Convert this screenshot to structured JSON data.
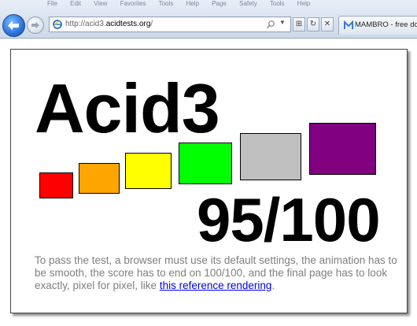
{
  "browser": {
    "menu_items": [
      "File",
      "Edit",
      "View",
      "Favorites",
      "Tools",
      "Help",
      "Page",
      "Safety",
      "Tools",
      "Help"
    ],
    "address": {
      "prefix": "http://acid3.",
      "domain": "acidtests.org",
      "suffix": "/"
    },
    "tab": {
      "label": "MAMBRO - free do"
    },
    "buttons": {
      "compat": "⊞",
      "refresh": "↻",
      "stop": "✕"
    }
  },
  "page": {
    "title": "Acid3",
    "score": "95/100",
    "instructions_text": "To pass the test, a browser must use its default settings, the animation has to be smooth, the score has to end on 100/100, and the final page has to look exactly, pixel for pixel, like ",
    "link_text": "this reference rendering",
    "instructions_end": ".",
    "boxes": [
      {
        "name": "red",
        "color": "#ff0000"
      },
      {
        "name": "orange",
        "color": "#ffa500"
      },
      {
        "name": "yellow",
        "color": "#ffff00"
      },
      {
        "name": "lime",
        "color": "#00ff00"
      },
      {
        "name": "gray",
        "color": "#c0c0c0"
      },
      {
        "name": "purple",
        "color": "#800080"
      }
    ]
  }
}
